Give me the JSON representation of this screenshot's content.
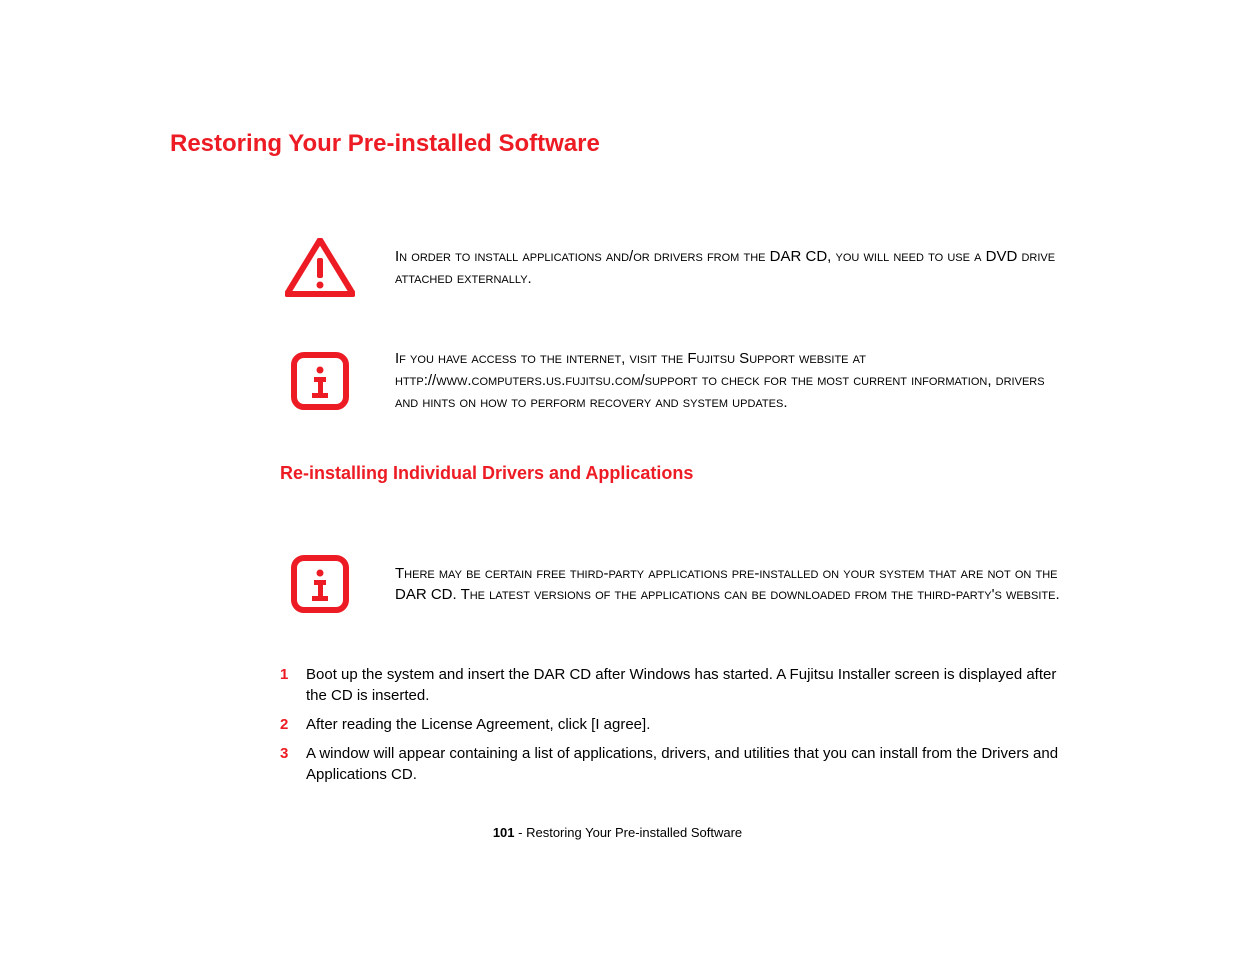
{
  "heading": "Restoring Your Pre-installed Software",
  "callouts": {
    "warning": "In order to install applications and/or drivers from the DAR CD, you will need to use a DVD drive attached externally.",
    "info1": "If you have access to the internet, visit the Fujitsu Support website at http://www.computers.us.fujitsu.com/support to check for the most current information, drivers and hints on how to perform recovery and system updates.",
    "info2": "There may be certain free third-party applications pre-installed on your system that are not on the DAR CD. The latest versions of the applications can be downloaded from the third-party's website."
  },
  "subheading": "Re-installing Individual Drivers and Applications",
  "steps": [
    "Boot up the system and insert the DAR CD after Windows has started. A Fujitsu Installer screen is displayed after the CD is inserted.",
    "After reading the License Agreement, click [I agree].",
    "A window will appear containing a list of applications, drivers, and utilities that you can install from the Drivers and Applications CD."
  ],
  "footer": {
    "page": "101",
    "sep": " - ",
    "title": "Restoring Your Pre-installed Software"
  },
  "stepnums": [
    "1",
    "2",
    "3"
  ]
}
